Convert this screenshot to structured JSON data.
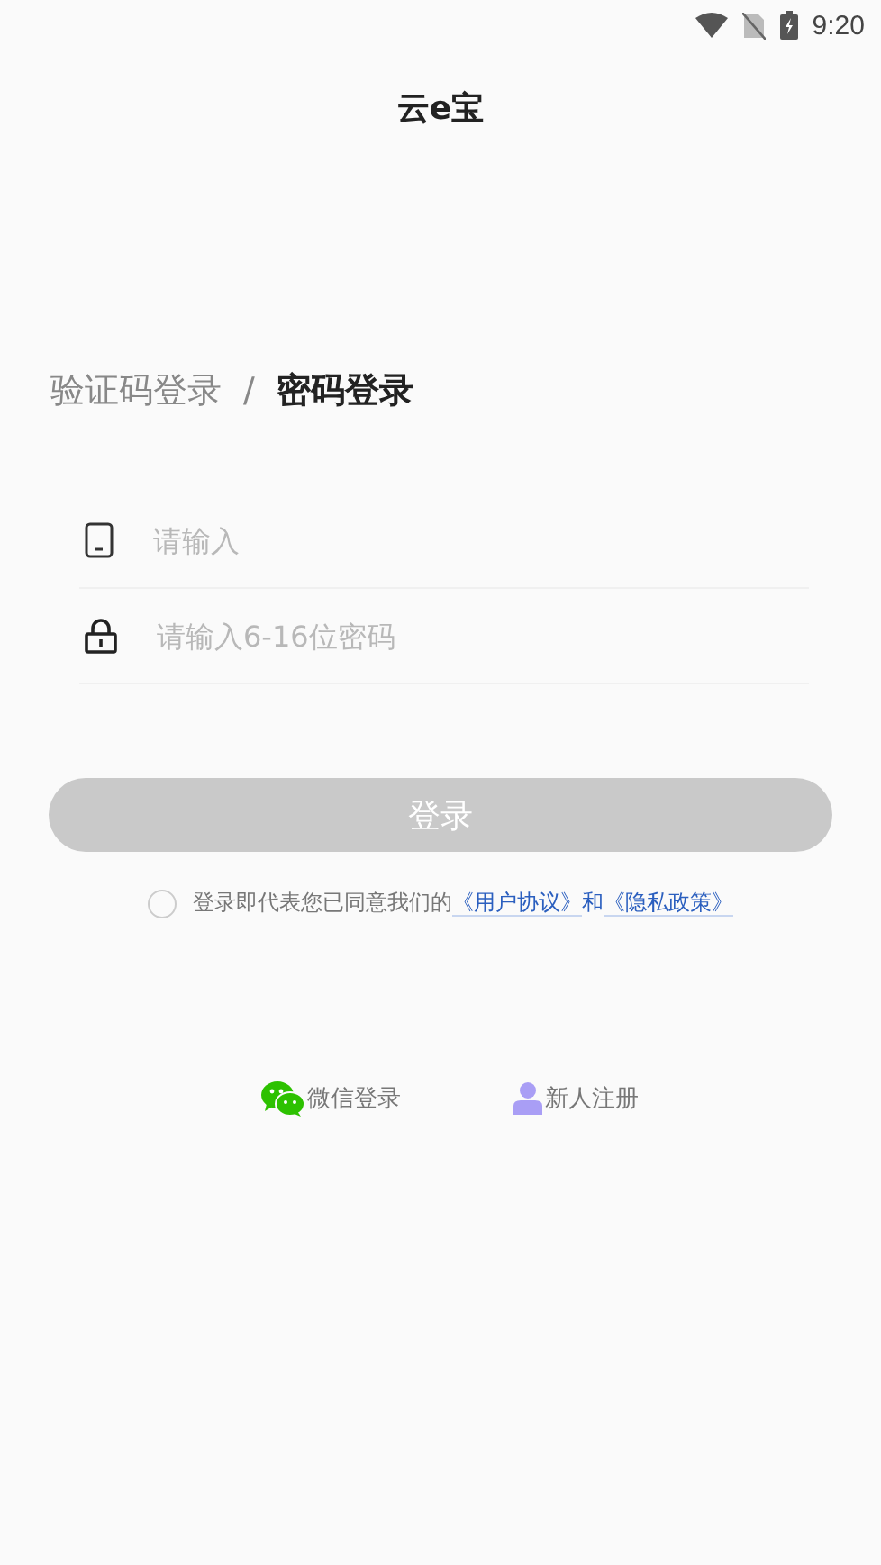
{
  "status_bar": {
    "time": "9:20"
  },
  "title": "云e宝",
  "login_tabs": [
    {
      "label": "验证码登录",
      "selected": false
    },
    {
      "label": "密码登录",
      "selected": true
    }
  ],
  "tab_separator": "/",
  "fields": [
    {
      "kind": "phone",
      "placeholder": "请输入"
    },
    {
      "kind": "password",
      "placeholder": "请输入6-16位密码"
    }
  ],
  "login_button": {
    "label": "登录",
    "disabled": true
  },
  "agreement": {
    "checked": false,
    "text": "登录即代表您已同意我们的",
    "links": [
      "《用户协议》",
      "《隐私政策》"
    ],
    "conjunction": "和"
  },
  "other_options": [
    {
      "kind": "wechat",
      "label": "微信登录"
    },
    {
      "kind": "register",
      "label": "新人注册"
    }
  ]
}
